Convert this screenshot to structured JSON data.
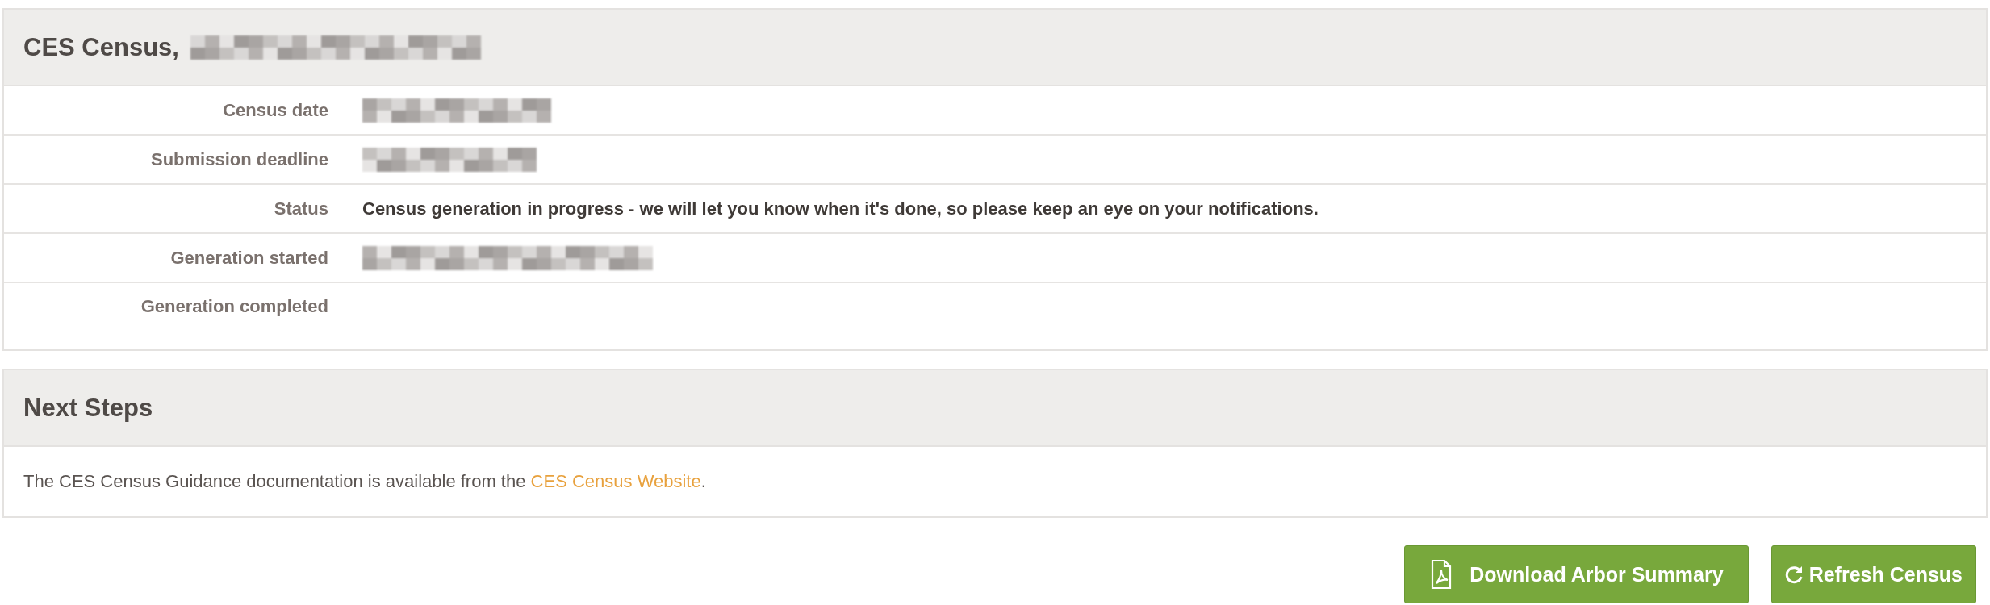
{
  "census_panel": {
    "title": "CES Census,",
    "title_redacted": true,
    "rows": [
      {
        "label": "Census date",
        "kind": "redacted"
      },
      {
        "label": "Submission deadline",
        "kind": "redacted"
      },
      {
        "label": "Status",
        "kind": "text",
        "value": "Census generation in progress - we will let you know when it's done, so please keep an eye on your notifications."
      },
      {
        "label": "Generation started",
        "kind": "redacted"
      },
      {
        "label": "Generation completed",
        "kind": "empty"
      }
    ]
  },
  "next_steps": {
    "title": "Next Steps",
    "text": "The CES Census Guidance documentation is available from the",
    "link": "CES Census Website",
    "after": "."
  },
  "buttons": [
    {
      "label": "Download Arbor Summary",
      "kind": "pdf"
    },
    {
      "label": "Refresh Census",
      "kind": "refresh"
    }
  ]
}
